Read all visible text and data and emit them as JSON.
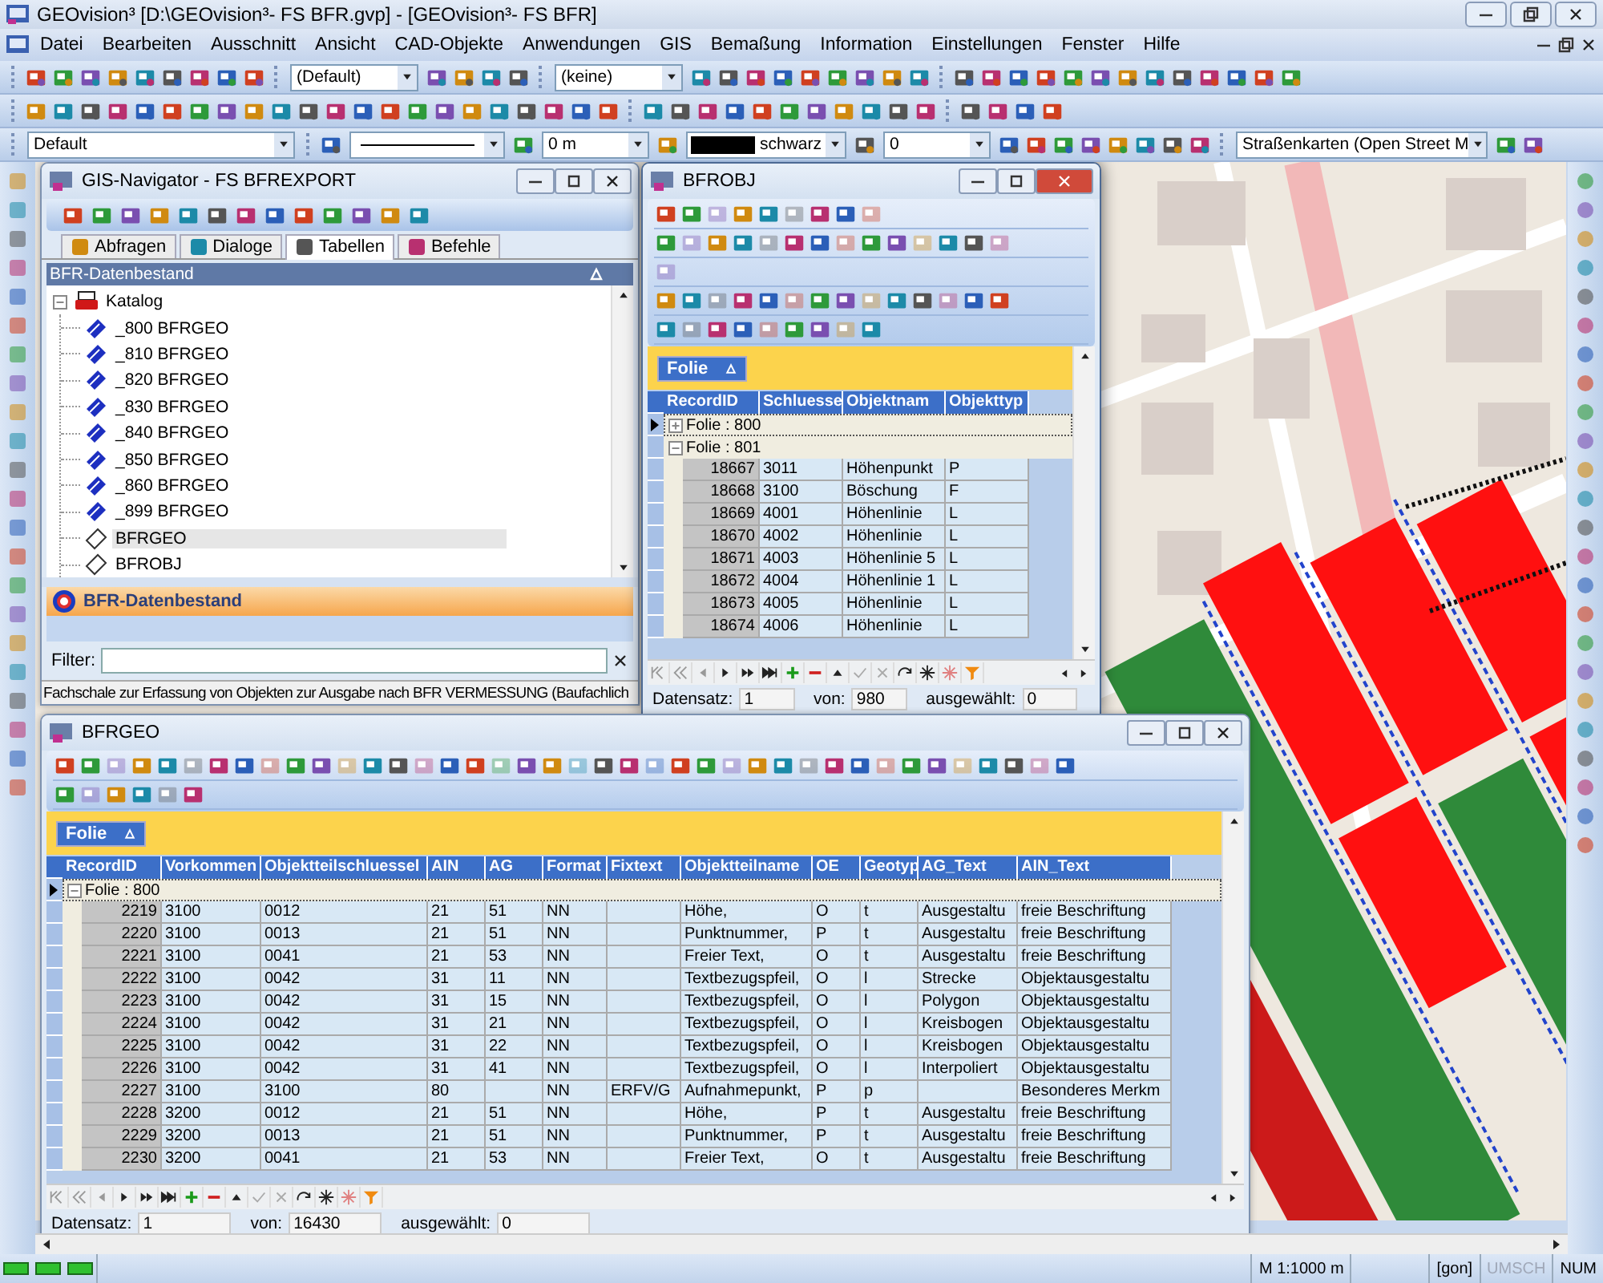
{
  "window": {
    "title": "GEOvision³  [D:\\GEOvision³- FS BFR.gvp] - [GEOvision³- FS BFR]"
  },
  "menu": [
    "Datei",
    "Bearbeiten",
    "Ausschnitt",
    "Ansicht",
    "CAD-Objekte",
    "Anwendungen",
    "GIS",
    "Bemaßung",
    "Information",
    "Einstellungen",
    "Fenster",
    "Hilfe"
  ],
  "toolbar": {
    "style_select": "(Default)",
    "layer_select": "(keine)",
    "theme_select": "Default",
    "line_width": "0 m",
    "color_name": "schwarz",
    "value_field": "0",
    "basemap_select": "Straßenkarten (Open Street M"
  },
  "navigator": {
    "title": "GIS-Navigator - FS BFREXPORT",
    "tabs": [
      {
        "label": "Abfragen",
        "selected": false
      },
      {
        "label": "Dialoge",
        "selected": false
      },
      {
        "label": "Tabellen",
        "selected": true
      },
      {
        "label": "Befehle",
        "selected": false
      }
    ],
    "tree_header": "BFR-Datenbestand",
    "tree": [
      {
        "label": "Katalog",
        "kind": "catalog",
        "expanded": true,
        "selected": false,
        "children": [
          {
            "label": "_800 BFRGEO",
            "kind": "view",
            "selected": false
          },
          {
            "label": "_810 BFRGEO",
            "kind": "view",
            "selected": false
          },
          {
            "label": "_820 BFRGEO",
            "kind": "view",
            "selected": false
          },
          {
            "label": "_830 BFRGEO",
            "kind": "view",
            "selected": false
          },
          {
            "label": "_840 BFRGEO",
            "kind": "view",
            "selected": false
          },
          {
            "label": "_850 BFRGEO",
            "kind": "view",
            "selected": false
          },
          {
            "label": "_860 BFRGEO",
            "kind": "view",
            "selected": false
          },
          {
            "label": "_899 BFRGEO",
            "kind": "view",
            "selected": false
          },
          {
            "label": "BFRGEO",
            "kind": "table",
            "selected": true
          },
          {
            "label": "BFROBJ",
            "kind": "table",
            "selected": false
          }
        ]
      }
    ],
    "panel_title": "BFR-Datenbestand",
    "filter_label": "Filter:",
    "description": "Fachschale zur Erfassung von Objekten zur Ausgabe nach BFR VERMESSUNG (Baufachlich"
  },
  "tables": [
    {
      "title": "BFROBJ",
      "active": true,
      "group_chip": "Folie",
      "columns": [
        "RecordID",
        "Schluesse",
        "Objektnam",
        "Objekttyp"
      ],
      "groups": [
        {
          "label": "Folie : 800",
          "expanded": false,
          "current": true
        },
        {
          "label": "Folie : 801",
          "expanded": true,
          "current": false,
          "rows": [
            [
              "18667",
              "3011",
              "Höhenpunkt",
              "P"
            ],
            [
              "18668",
              "3100",
              "Böschung",
              "F"
            ],
            [
              "18669",
              "4001",
              "Höhenlinie",
              "L"
            ],
            [
              "18670",
              "4002",
              "Höhenlinie",
              "L"
            ],
            [
              "18671",
              "4003",
              "Höhenlinie 5",
              "L"
            ],
            [
              "18672",
              "4004",
              "Höhenlinie 1",
              "L"
            ],
            [
              "18673",
              "4005",
              "Höhenlinie",
              "L"
            ],
            [
              "18674",
              "4006",
              "Höhenlinie",
              "L"
            ]
          ]
        }
      ],
      "footer": {
        "record_label": "Datensatz:",
        "record": "1",
        "total_label": "von:",
        "total": "980",
        "selected_label": "ausgewählt:",
        "selected_count": "0"
      }
    },
    {
      "title": "BFRGEO",
      "active": false,
      "group_chip": "Folie",
      "columns": [
        "RecordID",
        "Vorkommen",
        "Objektteilschluessel",
        "AIN",
        "AG",
        "Format",
        "Fixtext",
        "Objektteilname",
        "OE",
        "Geotyp",
        "AG_Text",
        "AIN_Text"
      ],
      "groups": [
        {
          "label": "Folie : 800",
          "expanded": true,
          "current": true,
          "rows": [
            [
              "2219",
              "3100",
              "0012",
              "21",
              "51",
              "NN",
              null,
              "Höhe,",
              "O",
              "t",
              "Ausgestaltu",
              "freie Beschriftung"
            ],
            [
              "2220",
              "3100",
              "0013",
              "21",
              "51",
              "NN",
              null,
              "Punktnummer,",
              "P",
              "t",
              "Ausgestaltu",
              "freie Beschriftung"
            ],
            [
              "2221",
              "3100",
              "0041",
              "21",
              "53",
              "NN",
              null,
              "Freier Text,",
              "O",
              "t",
              "Ausgestaltu",
              "freie Beschriftung"
            ],
            [
              "2222",
              "3100",
              "0042",
              "31",
              "11",
              "NN",
              null,
              "Textbezugspfeil,",
              "O",
              "l",
              "Strecke",
              "Objektausgestaltu"
            ],
            [
              "2223",
              "3100",
              "0042",
              "31",
              "15",
              "NN",
              null,
              "Textbezugspfeil,",
              "O",
              "l",
              "Polygon",
              "Objektausgestaltu"
            ],
            [
              "2224",
              "3100",
              "0042",
              "31",
              "21",
              "NN",
              null,
              "Textbezugspfeil,",
              "O",
              "l",
              "Kreisbogen",
              "Objektausgestaltu"
            ],
            [
              "2225",
              "3100",
              "0042",
              "31",
              "22",
              "NN",
              null,
              "Textbezugspfeil,",
              "O",
              "l",
              "Kreisbogen",
              "Objektausgestaltu"
            ],
            [
              "2226",
              "3100",
              "0042",
              "31",
              "41",
              "NN",
              null,
              "Textbezugspfeil,",
              "O",
              "l",
              "Interpoliert",
              "Objektausgestaltu"
            ],
            [
              "2227",
              "3100",
              "3100",
              "80",
              null,
              "NN",
              "ERFV/G",
              "Aufnahmepunkt,",
              "P",
              "p",
              null,
              "Besonderes Merkm"
            ],
            [
              "2228",
              "3200",
              "0012",
              "21",
              "51",
              "NN",
              null,
              "Höhe,",
              "P",
              "t",
              "Ausgestaltu",
              "freie Beschriftung"
            ],
            [
              "2229",
              "3200",
              "0013",
              "21",
              "51",
              "NN",
              null,
              "Punktnummer,",
              "P",
              "t",
              "Ausgestaltu",
              "freie Beschriftung"
            ],
            [
              "2230",
              "3200",
              "0041",
              "21",
              "53",
              "NN",
              null,
              "Freier Text,",
              "O",
              "t",
              "Ausgestaltu",
              "freie Beschriftung"
            ]
          ]
        }
      ],
      "footer": {
        "record_label": "Datensatz:",
        "record": "1",
        "total_label": "von:",
        "total": "16430",
        "selected_label": "ausgewählt:",
        "selected_count": "0"
      }
    }
  ],
  "status_bar": {
    "scale": "M 1:1000  m",
    "unit": "[gon]",
    "indicators": [
      {
        "label": "UMSCH",
        "on": false
      },
      {
        "label": "NUM",
        "on": true
      }
    ]
  }
}
